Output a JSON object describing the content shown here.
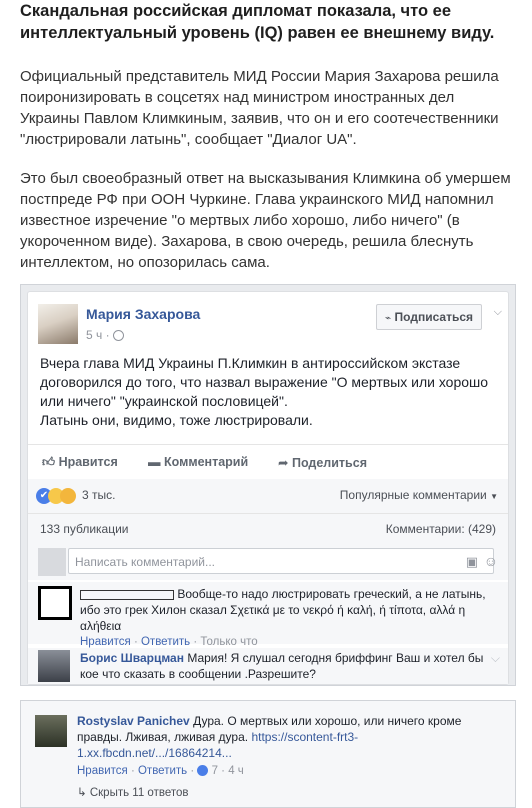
{
  "article": {
    "headline": "Скандальная российская дипломат показала, что ее интеллектуальный уровень (IQ) равен ее внешнему виду.",
    "paragraph1": "Официальный представитель МИД России Мария Захарова решила поиронизировать в соцсетях над министром иностранных дел Украины Павлом Климкиным, заявив, что он и его соотечественники \"люстрировали латынь\", сообщает \"Диалог UA\".",
    "paragraph2": "Это был своеобразный ответ на высказывания Климкина об умершем постпреде РФ при ООН Чуркине. Глава украинского МИД напомнил известное изречение \"о мертвых либо хорошо, либо ничего\" (в укороченном виде). Захарова, в свою очередь, решила блеснуть интеллектом, но опозорилась сама."
  },
  "post": {
    "author": "Мария Захарова",
    "time": "5 ч ·",
    "subscribe_label": "Подписаться",
    "text_line1": "Вчера глава МИД Украины П.Климкин в антироссийском экстазе",
    "text_line2": "договорился до того, что назвал выражение \"О мертвых или хорошо",
    "text_line3": "или ничего\" \"украинской пословицей\".",
    "text_line4": "Латынь они, видимо, тоже люстрировали.",
    "actions": {
      "like": "Нравится",
      "comment": "Комментарий",
      "share": "Поделиться"
    },
    "reactions_count": "3 тыс.",
    "sort_label": "Популярные комментарии",
    "shares": "133 публикации",
    "comments_count": "Комментарии: (429)",
    "comment_placeholder": "Написать комментарий..."
  },
  "comments": [
    {
      "author": "",
      "text_line1": "Вообще-то надо люстрировать греческий, а не латынь,",
      "text_line2": "ибо это грек Хилон сказал Σχετικά με το νεκρό ή καλή, ή τίποτα, αλλά η",
      "text_line3": "αλήθεια",
      "like": "Нравится",
      "reply": "Ответить",
      "only_now": "Только что"
    },
    {
      "author": "Борис Шварцман",
      "text_line1": "Мария! Я слушал сегодня бриффинг Ваш и хотел бы",
      "text_line2": "кое что сказать в сообщении .Разрешите?"
    },
    {
      "author": "Rostyslav Panichev",
      "text_line1": "Дура. О мертвых или хорошо, или ничего кроме",
      "text_line2": "правды. Лживая, лживая дура.",
      "link_line1": "https://scontent-frt3-",
      "link_line2": "1.xx.fbcdn.net/.../16864214...",
      "like": "Нравится",
      "reply": "Ответить",
      "likes_count": "7",
      "time": "4 ч",
      "more_replies": "Скрыть 11 ответов"
    }
  ],
  "colors": {
    "fb_blue": "#365899",
    "muted": "#90949c"
  }
}
